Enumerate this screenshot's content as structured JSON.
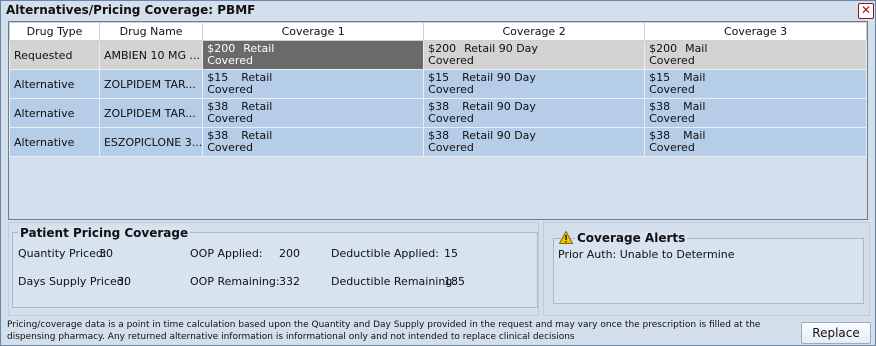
{
  "window": {
    "title": "Alternatives/Pricing Coverage: PBMF",
    "close_glyph": "✕"
  },
  "grid": {
    "headers": [
      "Drug Type",
      "Drug Name",
      "Coverage 1",
      "Coverage 2",
      "Coverage 3"
    ],
    "rows": [
      {
        "type": "Requested",
        "drug": "AMBIEN 10 MG ...",
        "c1": {
          "amount": "$200",
          "channel": "Retail",
          "status": "Covered"
        },
        "c2": {
          "amount": "$200",
          "channel": "Retail 90 Day",
          "status": "Covered"
        },
        "c3": {
          "amount": "$200",
          "channel": "Mail",
          "status": "Covered"
        }
      },
      {
        "type": "Alternative",
        "drug": "ZOLPIDEM TAR...",
        "c1": {
          "amount": "$15",
          "channel": "Retail",
          "status": "Covered"
        },
        "c2": {
          "amount": "$15",
          "channel": "Retail 90 Day",
          "status": "Covered"
        },
        "c3": {
          "amount": "$15",
          "channel": "Mail",
          "status": "Covered"
        }
      },
      {
        "type": "Alternative",
        "drug": "ZOLPIDEM TAR...",
        "c1": {
          "amount": "$38",
          "channel": "Retail",
          "status": "Covered"
        },
        "c2": {
          "amount": "$38",
          "channel": "Retail 90 Day",
          "status": "Covered"
        },
        "c3": {
          "amount": "$38",
          "channel": "Mail",
          "status": "Covered"
        }
      },
      {
        "type": "Alternative",
        "drug": "ESZOPICLONE 3...",
        "c1": {
          "amount": "$38",
          "channel": "Retail",
          "status": "Covered"
        },
        "c2": {
          "amount": "$38",
          "channel": "Retail 90 Day",
          "status": "Covered"
        },
        "c3": {
          "amount": "$38",
          "channel": "Mail",
          "status": "Covered"
        }
      }
    ]
  },
  "pricing": {
    "title": "Patient Pricing Coverage",
    "quantity_label": "Quantity Priced:",
    "quantity_value": "30",
    "days_label": "Days Supply Priced:",
    "days_value": "30",
    "oop_applied_label": "OOP Applied:",
    "oop_applied_value": "200",
    "oop_remaining_label": "OOP Remaining:",
    "oop_remaining_value": "332",
    "ded_applied_label": "Deductible Applied:",
    "ded_applied_value": "15",
    "ded_remaining_label": "Deductible Remaining:",
    "ded_remaining_value": "185"
  },
  "alerts": {
    "title": "Coverage Alerts",
    "icon": "warning-icon",
    "message": "Prior Auth: Unable to Determine"
  },
  "footer": {
    "disclaimer_line1": "Pricing/coverage data is a point in time calculation based upon the Quantity and Day Supply provided in the request and may vary once the prescription is filled at the",
    "disclaimer_line2": "dispensing pharmacy. Any returned alternative information is informational only and not intended to replace clinical decisions",
    "replace_label": "Replace"
  }
}
